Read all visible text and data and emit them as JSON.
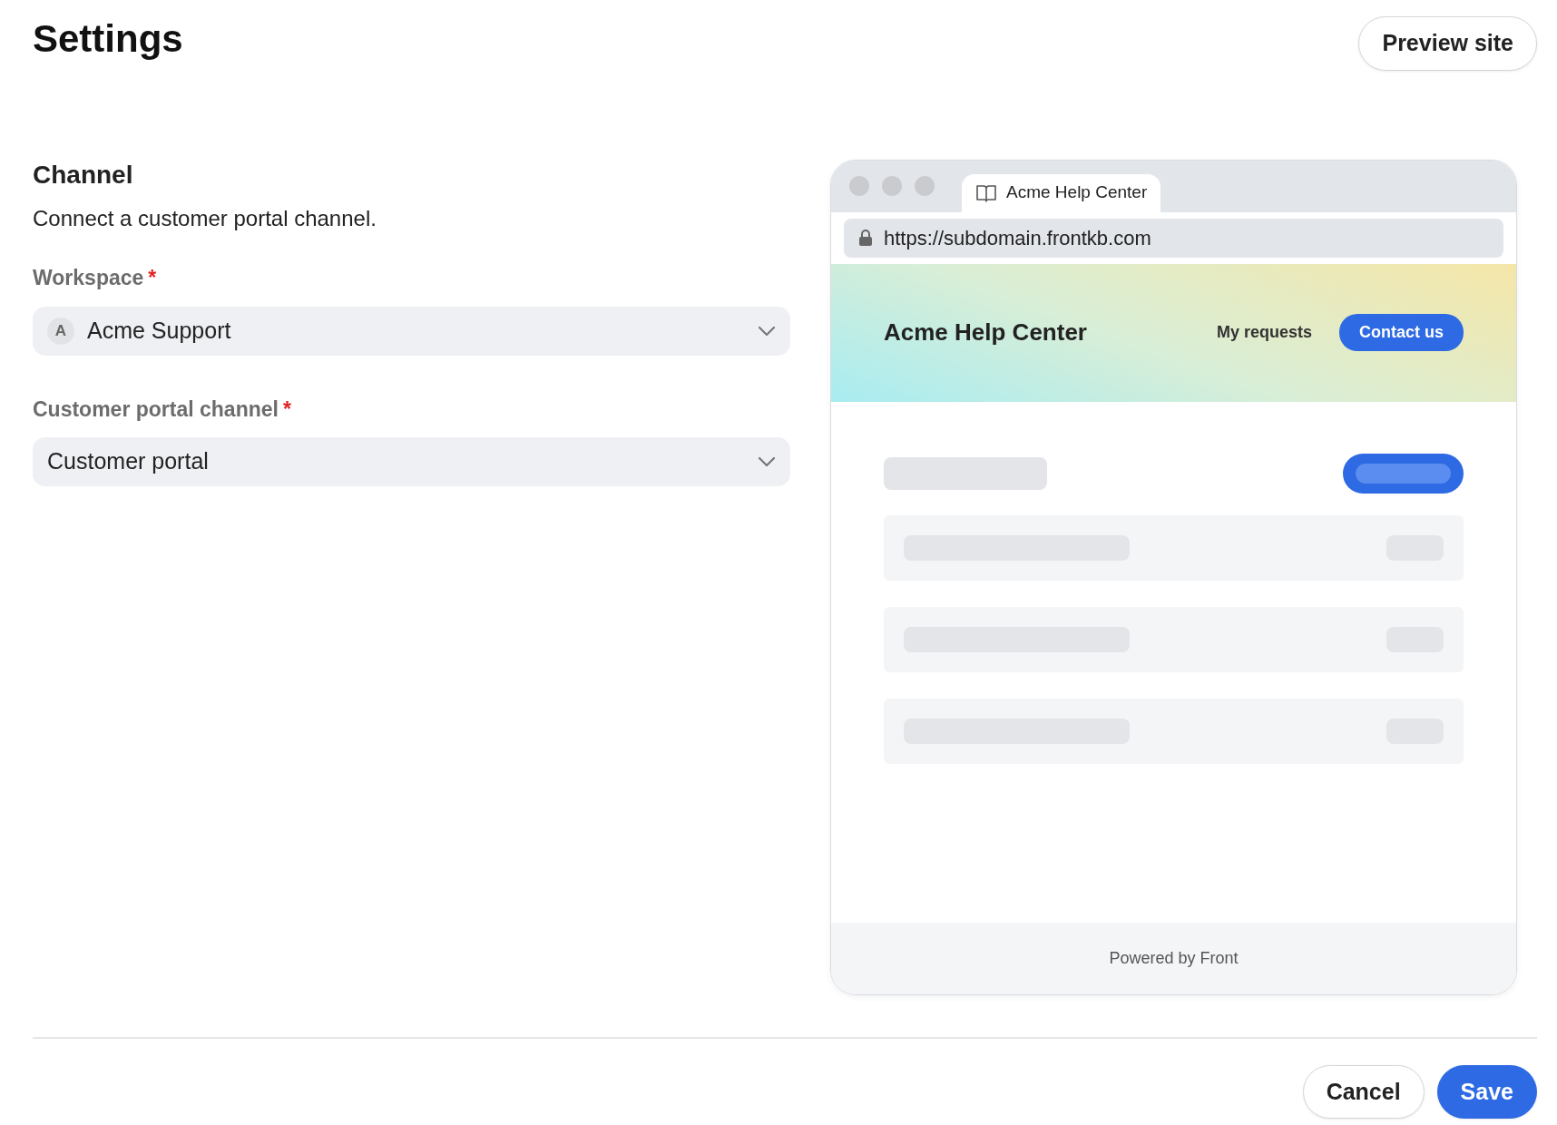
{
  "page": {
    "title": "Settings",
    "preview_button": "Preview site"
  },
  "section": {
    "heading": "Channel",
    "description": "Connect a customer portal channel."
  },
  "fields": [
    {
      "label": "Workspace",
      "required_mark": "*",
      "avatar": "A",
      "value": "Acme Support"
    },
    {
      "label": "Customer portal channel",
      "required_mark": "*",
      "value": "Customer portal"
    }
  ],
  "preview": {
    "tab_title": "Acme Help Center",
    "url": "https://subdomain.frontkb.com",
    "site_title": "Acme Help Center",
    "nav_link": "My requests",
    "contact_button": "Contact us",
    "footer": "Powered by Front"
  },
  "actions": [
    {
      "label": "Cancel",
      "kind": "secondary"
    },
    {
      "label": "Save",
      "kind": "primary"
    }
  ]
}
